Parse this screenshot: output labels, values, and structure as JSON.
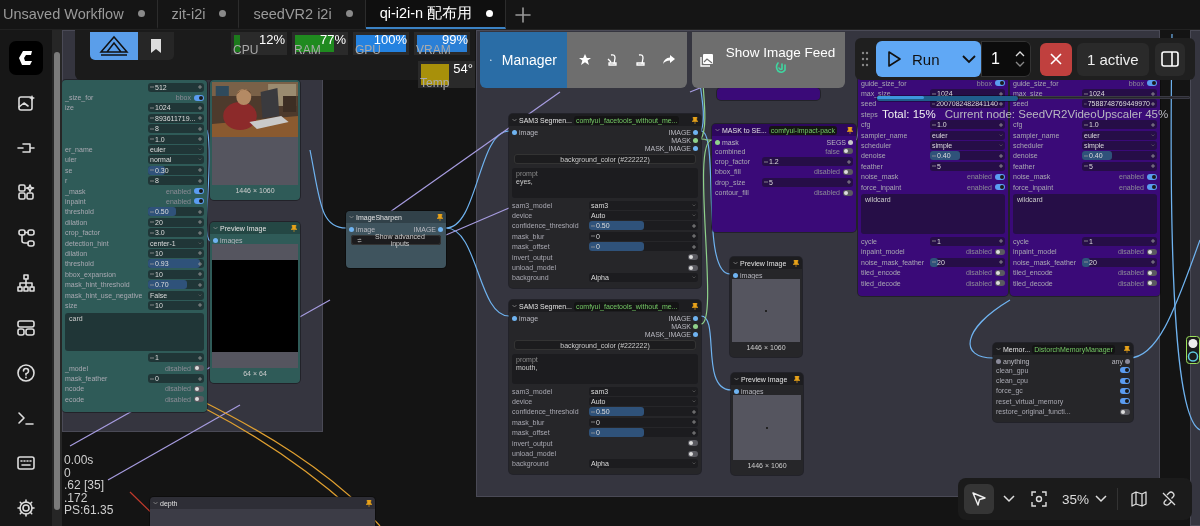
{
  "tabs": [
    {
      "label": "Unsaved Workflow",
      "selected": false,
      "modified": true
    },
    {
      "label": "zit-i2i",
      "selected": false,
      "modified": true
    },
    {
      "label": "seedVR2 i2i",
      "selected": false,
      "modified": true
    },
    {
      "label": "qi-i2i-n 配布用",
      "selected": true,
      "modified": true
    }
  ],
  "monitor": {
    "meters": [
      {
        "kind": "usage",
        "label": "CPU",
        "reading": "12%",
        "level": 0.12,
        "color": "#1c7a1c"
      },
      {
        "kind": "usage",
        "label": "RAM",
        "reading": "77%",
        "level": 0.77,
        "color": "#1f8a1f"
      },
      {
        "kind": "usage",
        "label": "GPU",
        "reading": "100%",
        "level": 1,
        "color": "#2482e0"
      },
      {
        "kind": "usage",
        "label": "VRAM",
        "reading": "99%",
        "level": 0.99,
        "color": "#2a7fd6"
      },
      {
        "kind": "temperature",
        "label": "Temp",
        "reading": "54°",
        "level": 0.54,
        "color": "#a8900a"
      }
    ]
  },
  "manager": {
    "label": "Manager"
  },
  "image_feed": {
    "label": "Show Image Feed"
  },
  "run": {
    "label": "Run",
    "batch_count": "1",
    "active": "1 active"
  },
  "progress": {
    "total": {
      "text": "Total: 15%",
      "level": 0.15
    },
    "node": {
      "text": "Current node: SeedVR2VideoUpscaler 45%",
      "level": 0.45
    }
  },
  "nodes": [
    {
      "color": "#2f5b58",
      "widgets": [
        {
          "kind": "number",
          "value": "512"
        },
        {
          "kind": "toggle",
          "label": "_size_for",
          "value": "bbox",
          "on": true
        },
        {
          "kind": "number",
          "label": "ize",
          "value": "1024"
        },
        {
          "kind": "number",
          "value": "893611719..."
        },
        {
          "kind": "number",
          "value": "8"
        },
        {
          "kind": "number",
          "value": "1.0"
        },
        {
          "kind": "combo",
          "label": "er_name",
          "value": "euler"
        },
        {
          "kind": "combo",
          "label": "uler",
          "value": "normal"
        },
        {
          "kind": "number",
          "label": "se",
          "value": "0.30",
          "level": 0.3
        },
        {
          "kind": "number",
          "label": "r",
          "value": "8"
        },
        {
          "kind": "toggle",
          "label": "_mask",
          "value": "enabled",
          "on": true
        },
        {
          "kind": "toggle",
          "label": "inpaint",
          "value": "enabled",
          "on": true
        },
        {
          "kind": "number",
          "label": "threshold",
          "value": "0.50",
          "level": 0.5
        },
        {
          "kind": "number",
          "label": "dilation",
          "value": "20"
        },
        {
          "kind": "number",
          "label": "crop_factor",
          "value": "3.0"
        },
        {
          "kind": "combo",
          "label": "detection_hint",
          "value": "center-1"
        },
        {
          "kind": "number",
          "label": "dilation",
          "value": "10"
        },
        {
          "kind": "number",
          "label": "threshold",
          "value": "0.93",
          "level": 0.93
        },
        {
          "kind": "number",
          "label": "bbox_expansion",
          "value": "10"
        },
        {
          "kind": "number",
          "label": "mask_hint_threshold",
          "value": "0.70",
          "level": 0.7
        },
        {
          "kind": "combo",
          "label": "mask_hint_use_negative",
          "value": "False"
        },
        {
          "kind": "number",
          "label": "size",
          "value": "10"
        },
        {
          "kind": "text",
          "value": "card"
        },
        {
          "kind": "number",
          "value": "1"
        },
        {
          "kind": "toggle",
          "label": "_model",
          "value": "disabled",
          "on": false
        },
        {
          "kind": "number",
          "label": "mask_feather",
          "value": "0"
        },
        {
          "kind": "toggle",
          "label": "ncode",
          "value": "disabled",
          "on": false
        },
        {
          "kind": "toggle",
          "label": "ecode",
          "value": "disabled",
          "on": false
        }
      ]
    },
    {
      "color": "#2f5b58",
      "caption": "1446 × 1060"
    },
    {
      "color": "#2f5b58",
      "title": "Preview Image",
      "inputs": [
        {
          "name": "images",
          "color": "#6fb3f0"
        }
      ],
      "image": {
        "kind": "black"
      },
      "caption": "64 × 64"
    },
    {
      "color": "#3f545e",
      "title": "ImageSharpen",
      "inputs": [
        {
          "name": "image",
          "color": "#6fb3f0"
        }
      ],
      "outputs": [
        {
          "name": "IMAGE",
          "color": "#6fb3f0"
        }
      ],
      "widgets": [
        {
          "kind": "expander",
          "label": "Show advanced inputs"
        }
      ]
    },
    {
      "color": "#262629",
      "title": "SAM3 Segmen...",
      "badge": "comfyui_facetools_without_me...",
      "inputs": [
        {
          "name": "image",
          "color": "#6fb3f0"
        }
      ],
      "outputs": [
        {
          "name": "IMAGE",
          "color": "#6fb3f0"
        },
        {
          "name": "MASK",
          "color": "#8fd18a"
        },
        {
          "name": "MASK_IMAGE",
          "color": "#6fb3f0"
        }
      ],
      "widgets": [
        {
          "kind": "button",
          "label": "background_color (#222222)"
        },
        {
          "kind": "text",
          "label": "prompt",
          "value": "eyes,"
        },
        {
          "kind": "combo",
          "label": "sam3_model",
          "value": "sam3"
        },
        {
          "kind": "combo",
          "label": "device",
          "value": "Auto"
        },
        {
          "kind": "number",
          "label": "confidence_threshold",
          "value": "0.50",
          "level": 0.5
        },
        {
          "kind": "number",
          "label": "mask_blur",
          "value": "0"
        },
        {
          "kind": "number",
          "label": "mask_offset",
          "value": "0",
          "level": 0.5
        },
        {
          "kind": "toggle",
          "label": "invert_output",
          "on": false
        },
        {
          "kind": "toggle",
          "label": "unload_model",
          "on": false
        },
        {
          "kind": "combo",
          "label": "background",
          "value": "Alpha"
        }
      ]
    },
    {
      "color": "#262629",
      "title": "SAM3 Segmen...",
      "badge": "comfyui_facetools_without_me...",
      "inputs": [
        {
          "name": "image",
          "color": "#6fb3f0"
        }
      ],
      "outputs": [
        {
          "name": "IMAGE",
          "color": "#6fb3f0"
        },
        {
          "name": "MASK",
          "color": "#8fd18a"
        },
        {
          "name": "MASK_IMAGE",
          "color": "#6fb3f0"
        }
      ],
      "widgets": [
        {
          "kind": "button",
          "label": "background_color (#222222)"
        },
        {
          "kind": "text",
          "label": "prompt",
          "value": "mouth,"
        },
        {
          "kind": "combo",
          "label": "sam3_model",
          "value": "sam3"
        },
        {
          "kind": "combo",
          "label": "device",
          "value": "Auto"
        },
        {
          "kind": "number",
          "label": "confidence_threshold",
          "value": "0.50",
          "level": 0.5
        },
        {
          "kind": "number",
          "label": "mask_blur",
          "value": "0"
        },
        {
          "kind": "number",
          "label": "mask_offset",
          "value": "0",
          "level": 0.5
        },
        {
          "kind": "toggle",
          "label": "invert_output",
          "on": false
        },
        {
          "kind": "toggle",
          "label": "unload_model",
          "on": false
        },
        {
          "kind": "combo",
          "label": "background",
          "value": "Alpha"
        }
      ]
    },
    {
      "color": "#3a0a78",
      "title": "MASK to SE...",
      "badge": "comfyui-impact-pack",
      "inputs": [
        {
          "name": "mask",
          "color": "#8fd18a"
        }
      ],
      "outputs": [
        {
          "name": "SEGS",
          "color": "#c8c8c8"
        }
      ],
      "widgets": [
        {
          "kind": "toggle",
          "label": "combined",
          "value": "false",
          "on": false
        },
        {
          "kind": "number",
          "label": "crop_factor",
          "value": "1.2"
        },
        {
          "kind": "toggle",
          "label": "bbox_fill",
          "value": "disabled",
          "on": false
        },
        {
          "kind": "number",
          "label": "drop_size",
          "value": "5"
        },
        {
          "kind": "toggle",
          "label": "contour_fill",
          "value": "disabled",
          "on": false
        }
      ]
    },
    {
      "color": "#262629",
      "title": "Preview Image",
      "inputs": [
        {
          "name": "images",
          "color": "#6fb3f0"
        }
      ],
      "image": {
        "kind": "empty"
      },
      "caption": "1446 × 1060"
    },
    {
      "color": "#262629",
      "title": "Preview Image",
      "inputs": [
        {
          "name": "images",
          "color": "#6fb3f0"
        }
      ],
      "image": {
        "kind": "empty"
      },
      "caption": "1446 × 1060"
    },
    {
      "color": "#3a0a78",
      "widgets": [
        {
          "kind": "toggle",
          "label": "guide_size_for",
          "value": "bbox",
          "on": true
        },
        {
          "kind": "number",
          "label": "max_size",
          "value": "1024"
        },
        {
          "kind": "number",
          "label": "seed",
          "value": "2007082482841140"
        },
        {
          "kind": "number",
          "label": "steps"
        },
        {
          "kind": "number",
          "label": "cfg",
          "value": "1.0"
        },
        {
          "kind": "combo",
          "label": "sampler_name",
          "value": "euler"
        },
        {
          "kind": "combo",
          "label": "scheduler",
          "value": "simple"
        },
        {
          "kind": "number",
          "label": "denoise",
          "value": "0.40",
          "level": 0.4
        },
        {
          "kind": "number",
          "label": "feather",
          "value": "5"
        },
        {
          "kind": "toggle",
          "label": "noise_mask",
          "value": "enabled",
          "on": true
        },
        {
          "kind": "toggle",
          "label": "force_inpaint",
          "value": "enabled",
          "on": true
        },
        {
          "kind": "text",
          "value": "wildcard"
        },
        {
          "kind": "number",
          "label": "cycle",
          "value": "1"
        },
        {
          "kind": "toggle",
          "label": "inpaint_model",
          "value": "disabled",
          "on": false
        },
        {
          "kind": "number",
          "label": "noise_mask_feather",
          "value": "20",
          "level": 0.1
        },
        {
          "kind": "toggle",
          "label": "tiled_encode",
          "value": "disabled",
          "on": false
        },
        {
          "kind": "toggle",
          "label": "tiled_decode",
          "value": "disabled",
          "on": false
        }
      ]
    },
    {
      "color": "#3a0a78",
      "widgets": [
        {
          "kind": "toggle",
          "label": "guide_size_for",
          "value": "bbox",
          "on": true
        },
        {
          "kind": "number",
          "label": "max_size",
          "value": "1024"
        },
        {
          "kind": "number",
          "label": "seed",
          "value": "7588748769449970"
        },
        {
          "kind": "number"
        },
        {
          "kind": "number",
          "label": "cfg",
          "value": "1.0"
        },
        {
          "kind": "combo",
          "label": "sampler_name",
          "value": "euler"
        },
        {
          "kind": "combo",
          "label": "scheduler",
          "value": "simple"
        },
        {
          "kind": "number",
          "label": "denoise",
          "value": "0.40",
          "level": 0.4
        },
        {
          "kind": "number",
          "label": "feather",
          "value": "5"
        },
        {
          "kind": "toggle",
          "label": "noise_mask",
          "value": "enabled",
          "on": true
        },
        {
          "kind": "toggle",
          "label": "force_inpaint",
          "value": "enabled",
          "on": true
        },
        {
          "kind": "text",
          "value": "wildcard"
        },
        {
          "kind": "number",
          "label": "cycle",
          "value": "1"
        },
        {
          "kind": "toggle",
          "label": "inpaint_model",
          "value": "disabled",
          "on": false
        },
        {
          "kind": "number",
          "label": "noise_mask_feather",
          "value": "20",
          "level": 0.1
        },
        {
          "kind": "toggle",
          "label": "tiled_encode",
          "value": "disabled",
          "on": false
        },
        {
          "kind": "toggle",
          "label": "tiled_decode",
          "value": "disabled",
          "on": false
        }
      ]
    },
    {
      "color": "#262629",
      "title": "Memor...",
      "badge": "DistorchMemoryManager",
      "inputs": [
        {
          "name": "anything",
          "color": "#8a8a9a"
        }
      ],
      "outputs": [
        {
          "name": "any",
          "color": "#8a8a9a"
        }
      ],
      "widgets": [
        {
          "kind": "toggle",
          "label": "clean_gpu",
          "on": true
        },
        {
          "kind": "toggle",
          "label": "clean_cpu",
          "on": true
        },
        {
          "kind": "toggle",
          "label": "force_gc",
          "on": true
        },
        {
          "kind": "toggle",
          "label": "reset_virtual_memory",
          "on": true
        },
        {
          "kind": "toggle",
          "label": "restore_original_functi...",
          "on": false
        }
      ]
    },
    {
      "color": "#3c3c46",
      "title": "depth"
    },
    {
      "color": "#3a0a78"
    }
  ],
  "stats": {
    "lines": [
      "0.00s",
      "0",
      ".62 [35]",
      ".172",
      "PS:61.35"
    ]
  },
  "canvas_toolbar": {
    "pointer_selected": true,
    "zoom": "35%"
  }
}
